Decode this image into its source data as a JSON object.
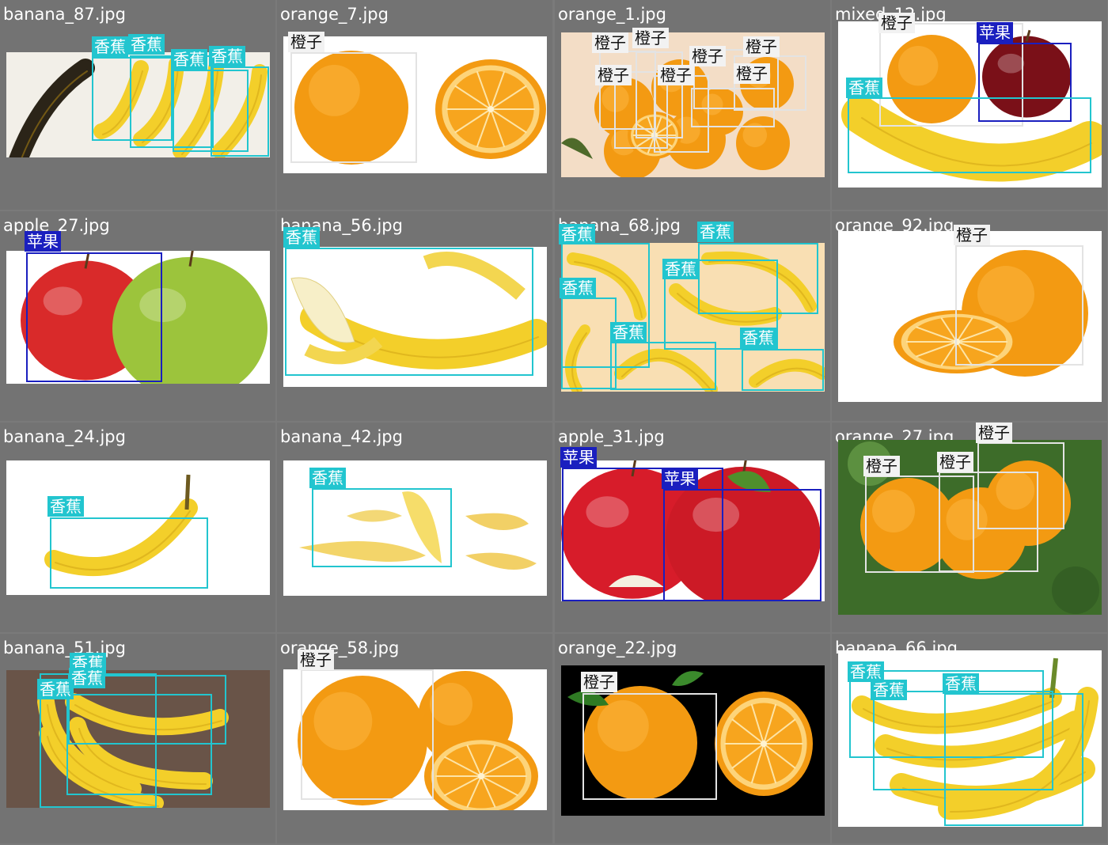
{
  "class_colors": {
    "banana": {
      "box": "#22c5cf",
      "label_bg": "#22c5cf",
      "label_fg": "#ffffff"
    },
    "orange": {
      "box": "#e3e3e3",
      "label_bg": "#f2f2f2",
      "label_fg": "#111111"
    },
    "apple": {
      "box": "#1a1fbf",
      "label_bg": "#1a1fbf",
      "label_fg": "#ffffff"
    }
  },
  "class_labels": {
    "banana": "香蕉",
    "orange": "橙子",
    "apple": "苹果"
  },
  "cells": [
    {
      "filename": "banana_87.jpg",
      "background": "banana-bunch-photo",
      "detections": [
        "banana",
        "banana",
        "banana",
        "banana"
      ]
    },
    {
      "filename": "orange_7.jpg",
      "background": "orange-and-half-photo",
      "detections": [
        "orange"
      ]
    },
    {
      "filename": "orange_1.jpg",
      "background": "orange-pile-photo",
      "detections": [
        "orange",
        "orange",
        "orange",
        "orange",
        "orange",
        "orange",
        "orange"
      ]
    },
    {
      "filename": "mixed_12.jpg",
      "background": "mixed-fruit-photo",
      "detections": [
        "orange",
        "apple",
        "banana"
      ]
    },
    {
      "filename": "apple_27.jpg",
      "background": "red-green-apple-photo",
      "detections": [
        "apple"
      ]
    },
    {
      "filename": "banana_56.jpg",
      "background": "peeled-banana-photo",
      "detections": [
        "banana"
      ]
    },
    {
      "filename": "banana_68.jpg",
      "background": "scattered-bananas-photo",
      "detections": [
        "banana",
        "banana",
        "banana",
        "banana",
        "banana",
        "banana"
      ]
    },
    {
      "filename": "orange_92.jpg",
      "background": "orange-with-slice-photo",
      "detections": [
        "orange"
      ]
    },
    {
      "filename": "banana_24.jpg",
      "background": "single-banana-photo",
      "detections": [
        "banana"
      ]
    },
    {
      "filename": "banana_42.jpg",
      "background": "banana-peel-photo",
      "detections": [
        "banana"
      ]
    },
    {
      "filename": "apple_31.jpg",
      "background": "red-apples-photo",
      "detections": [
        "apple",
        "apple"
      ]
    },
    {
      "filename": "orange_27.jpg",
      "background": "oranges-on-tree-photo",
      "detections": [
        "orange",
        "orange",
        "orange"
      ]
    },
    {
      "filename": "banana_51.jpg",
      "background": "bananas-on-wood-photo",
      "detections": [
        "banana",
        "banana",
        "banana"
      ]
    },
    {
      "filename": "orange_58.jpg",
      "background": "orange-halves-photo",
      "detections": [
        "orange"
      ]
    },
    {
      "filename": "orange_22.jpg",
      "background": "orange-on-black-photo",
      "detections": [
        "orange"
      ]
    },
    {
      "filename": "banana_66.jpg",
      "background": "banana-bunch-white-photo",
      "detections": [
        "banana",
        "banana",
        "banana"
      ]
    }
  ]
}
